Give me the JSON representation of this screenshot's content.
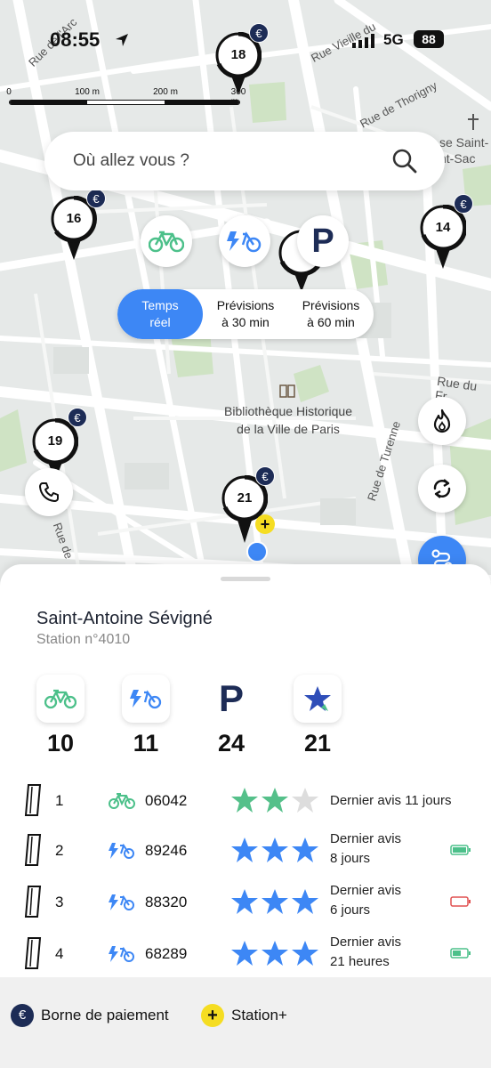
{
  "status_bar": {
    "time": "08:55",
    "network": "5G",
    "battery": "88"
  },
  "scale_bar": {
    "labels": [
      "0",
      "100 m",
      "200 m",
      "300 m"
    ]
  },
  "search": {
    "placeholder": "Où allez vous ?"
  },
  "filters": {
    "bike_icon": "mechanical-bike-icon",
    "ebike_icon": "electric-bike-icon",
    "parking_label": "P"
  },
  "time_modes": [
    {
      "line1": "Temps",
      "line2": "réel",
      "active": true
    },
    {
      "line1": "Prévisions",
      "line2": "à 30 min",
      "active": false
    },
    {
      "line1": "Prévisions",
      "line2": "à 60 min",
      "active": false
    }
  ],
  "map": {
    "streets": [
      "Rue de Turenne",
      "Rue du Fr",
      "Rue de",
      "Rue Vieille du",
      "Rue de Thorigny",
      "Rue de l'Arc",
      "se Saint-",
      "nt-Sac"
    ],
    "poi": {
      "line1": "Bibliothèque Historique",
      "line2": "de la Ville de Paris"
    },
    "stations": [
      {
        "count": "18",
        "euro": true
      },
      {
        "count": "16",
        "euro": true
      },
      {
        "count": "14",
        "euro": true
      },
      {
        "count": "19",
        "euro": true
      },
      {
        "count": "21",
        "euro": true,
        "plus": true
      },
      {
        "count": "",
        "euro": false
      }
    ],
    "euro_symbol": "€",
    "plus_symbol": "+"
  },
  "side_buttons": [
    "flame-icon",
    "refresh-icon",
    "phone-icon",
    "route-icon"
  ],
  "station": {
    "name": "Saint-Antoine Sévigné",
    "number": "Station n°4010",
    "availability": [
      {
        "type": "mechanical",
        "count": "10"
      },
      {
        "type": "electric",
        "count": "11"
      },
      {
        "type": "parking",
        "label": "P",
        "count": "24"
      },
      {
        "type": "favorite",
        "count": "21"
      }
    ],
    "docks": [
      {
        "index": "1",
        "bike_type": "mechanical",
        "bike_id": "06042",
        "rating": 2,
        "review_line1": "Dernier avis 11 jours",
        "review_line2": "",
        "battery": ""
      },
      {
        "index": "2",
        "bike_type": "electric",
        "bike_id": "89246",
        "rating": 3,
        "review_line1": "Dernier avis",
        "review_line2": "8 jours",
        "battery": "full"
      },
      {
        "index": "3",
        "bike_type": "electric",
        "bike_id": "88320",
        "rating": 3,
        "review_line1": "Dernier avis",
        "review_line2": "6 jours",
        "battery": "empty"
      },
      {
        "index": "4",
        "bike_type": "electric",
        "bike_id": "68289",
        "rating": 3,
        "review_line1": "Dernier avis",
        "review_line2": "21 heures",
        "battery": "medium"
      }
    ]
  },
  "legend": {
    "payment_symbol": "€",
    "payment_label": "Borne de paiement",
    "plus_symbol": "+",
    "plus_label": "Station+"
  },
  "colors": {
    "accent": "#3d87f5",
    "green": "#4cc08a",
    "navy": "#1d2c56",
    "yellow": "#f5dd22"
  }
}
